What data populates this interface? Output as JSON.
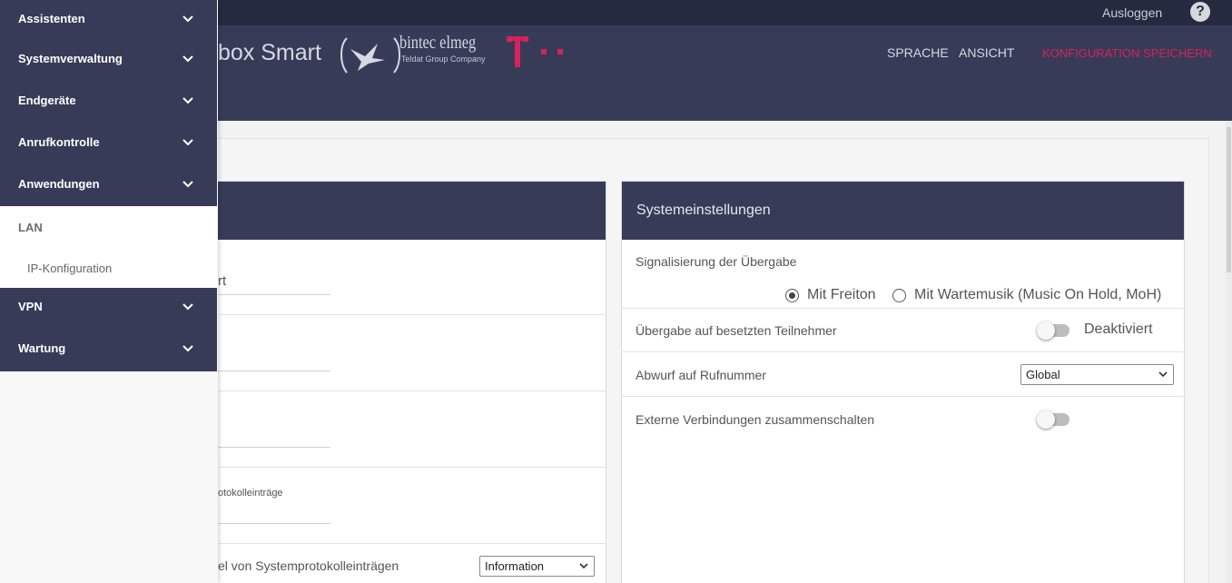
{
  "topbar": {
    "logout": "Ausloggen",
    "help": "?"
  },
  "header": {
    "product": "box Smart",
    "brand_main": "bintec elmeg",
    "brand_sub": "Teldat Group Company",
    "nav": [
      "SPRACHE",
      "ANSICHT",
      "KONFIGURATION SPEICHERN"
    ],
    "accent_color": "#d7225c"
  },
  "left_panel": {
    "field_1_partial": "rt",
    "syslog_partial": "otokolleinträge",
    "syslog_level_label_partial": "el von Systemprotokolleinträgen",
    "syslog_level_value": "Information"
  },
  "right_panel": {
    "title": "Systemeinstellungen",
    "transfer_signal_label": "Signalisierung der Übergabe",
    "radio_options": [
      "Mit Freiton",
      "Mit Wartemusik (Music On Hold, MoH)"
    ],
    "radio_selected": "Mit Freiton",
    "busy_transfer_label": "Übergabe auf besetzten Teilnehmer",
    "busy_transfer_state": "Deaktiviert",
    "drop_label": "Abwurf auf Rufnummer",
    "drop_value": "Global",
    "external_label": "Externe Verbindungen zusammenschalten"
  },
  "sidebar": {
    "items": [
      {
        "label": "Assistenten"
      },
      {
        "label": "Systemverwaltung"
      },
      {
        "label": "Endgeräte"
      },
      {
        "label": "Anrufkontrolle"
      },
      {
        "label": "Anwendungen"
      }
    ],
    "open_section": {
      "label": "LAN",
      "children": [
        "IP-Konfiguration"
      ]
    },
    "items_after": [
      {
        "label": "VPN"
      },
      {
        "label": "Wartung"
      }
    ]
  }
}
